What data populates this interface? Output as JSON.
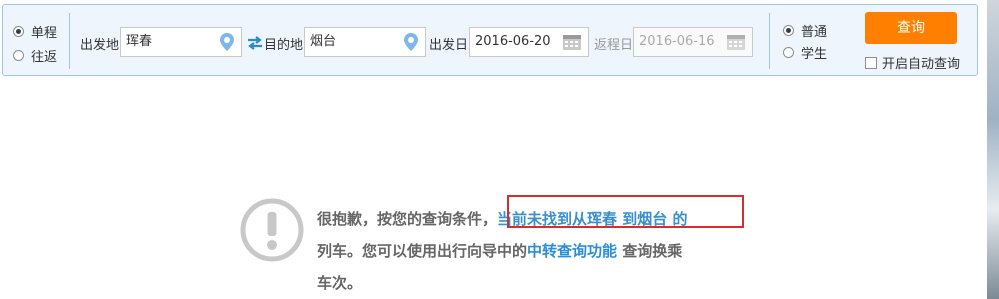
{
  "trip_type": {
    "one_way": "单程",
    "round_trip": "往返",
    "selected": "单程"
  },
  "from": {
    "label": "出发地",
    "value": "珲春"
  },
  "to": {
    "label": "目的地",
    "value": "烟台"
  },
  "depart": {
    "label": "出发日",
    "value": "2016-06-20"
  },
  "return": {
    "label": "返程日",
    "value": "2016-06-16"
  },
  "passenger": {
    "normal": "普通",
    "student": "学生",
    "selected": "普通"
  },
  "search_button": "查询",
  "auto_query": "开启自动查询",
  "message": {
    "part1": "很抱歉，按您的查询条件，",
    "part2": "当前未找到从珲春 到烟台 的",
    "part3": "列车。您可以使用出行向导中的",
    "link": "中转查询功能",
    "part4": " 查询换乘",
    "part5": "车次。"
  },
  "colors": {
    "accent": "#ff8000",
    "panel_border": "#9ec4e6",
    "highlight_box": "#d42f2f",
    "link": "#2c8ed8"
  }
}
